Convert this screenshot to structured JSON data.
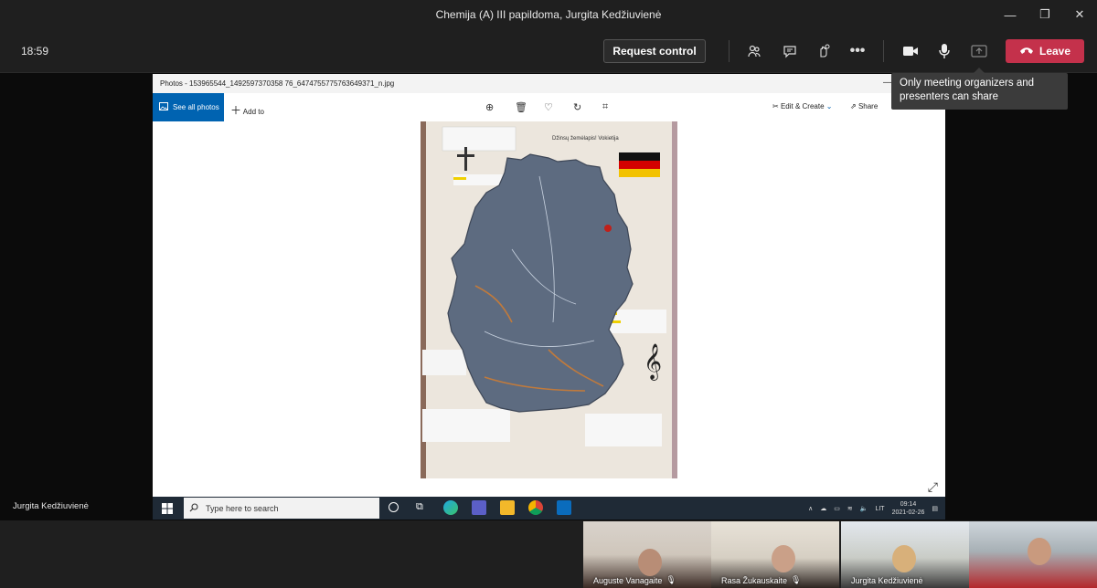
{
  "window": {
    "title": "Chemija (A) III papildoma, Jurgita Kedžiuvienė",
    "controls": [
      "minimize-icon",
      "restore-icon",
      "close-icon"
    ]
  },
  "callbar": {
    "time": "18:59",
    "request_control_label": "Request control",
    "leave_label": "Leave",
    "icons": [
      "participants-icon",
      "chat-icon",
      "reactions-icon",
      "more-icon",
      "camera-icon",
      "microphone-icon",
      "share-icon"
    ]
  },
  "tooltip": {
    "text": "Only meeting organizers and presenters can share"
  },
  "photos_app": {
    "title": "Photos - 153965544_1492597370358 76_6474755775763649371_n.jpg",
    "see_all_photos": "See all photos",
    "add_to": "Add to",
    "edit_create": "Edit & Create",
    "share": "Share",
    "photo_caption": "Džinsų žemėlapis! Vokietija"
  },
  "taskbar": {
    "search_placeholder": "Type here to search",
    "language": "LIT",
    "time": "09:14",
    "date": "2021-02-26"
  },
  "presenter_name": "Jurgita Kedžiuvienė",
  "participants": [
    {
      "name": "Auguste Vanagaite"
    },
    {
      "name": "Rasa Žukauskaite"
    },
    {
      "name": "Jurgita Kedžiuvienė"
    },
    {
      "name": ""
    }
  ],
  "colors": {
    "leave": "#c4314b",
    "photos_accent": "#0063b1",
    "teams_bg": "#1f1f1f"
  }
}
